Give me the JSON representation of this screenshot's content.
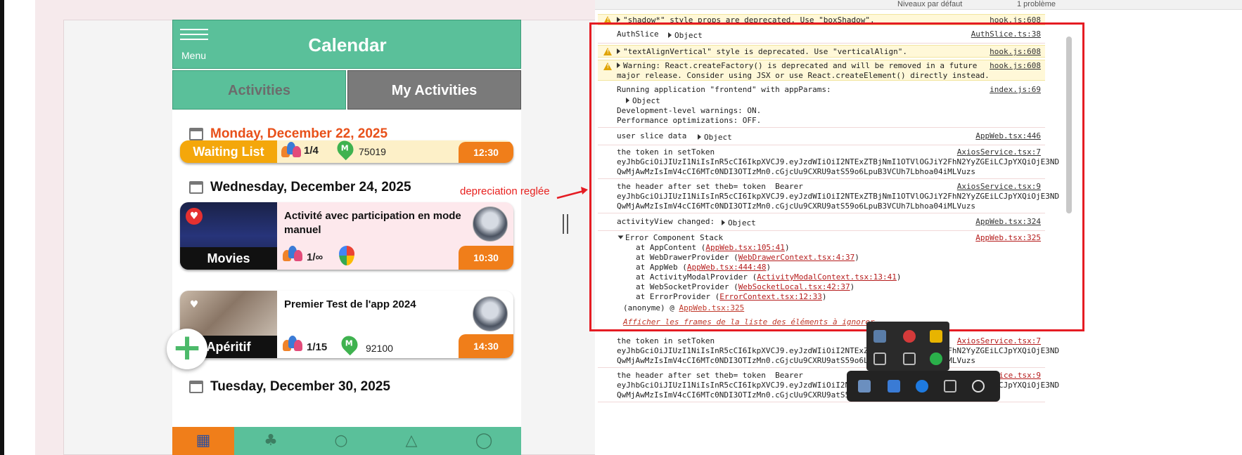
{
  "app": {
    "menu_label": "Menu",
    "title": "Calendar",
    "tabs": [
      "Activities",
      "My Activities"
    ]
  },
  "feed": {
    "sections": [
      {
        "date": "Monday, December 22, 2025",
        "date_color": "#e8501a",
        "card": {
          "category": "Waiting List",
          "participants": "1/4",
          "postal_code": "75019",
          "time": "12:30"
        }
      },
      {
        "date": "Wednesday, December 24, 2025",
        "card": {
          "title": "Activité avec participation en mode manuel",
          "category": "Movies",
          "participants": "1/∞",
          "time": "10:30"
        }
      },
      {
        "card": {
          "title": "Premier Test de l'app 2024",
          "category": "Apéritif",
          "participants": "1/15",
          "postal_code": "92100",
          "time": "14:30"
        }
      },
      {
        "date": "Tuesday, December 30, 2025"
      }
    ],
    "fab_label": "+"
  },
  "annotation": {
    "text": "depreciation reglée"
  },
  "console": {
    "top_bar": [
      "Niveaux par défaut",
      "1 problème"
    ],
    "messages": [
      {
        "level": "warning",
        "text": "\"shadow*\" style props are deprecated. Use \"boxShadow\".",
        "source": "hook.js:608"
      },
      {
        "level": "info",
        "text": "AuthSlice",
        "object": "Object",
        "source": "AuthSlice.ts:38"
      },
      {
        "level": "warning",
        "text": "\"textAlignVertical\" style is deprecated. Use \"verticalAlign\".",
        "source": "hook.js:608"
      },
      {
        "level": "warning",
        "text": "Warning: React.createFactory() is deprecated and will be removed in a future\nmajor release. Consider using JSX or use React.createElement() directly instead.",
        "source": "hook.js:608"
      },
      {
        "level": "info",
        "text": "Running application \"frontend\" with appParams:",
        "object": "Object",
        "text2": "Development-level warnings: ON.\nPerformance optimizations: OFF.",
        "source": "index.js:69"
      },
      {
        "level": "info",
        "text": "user slice data",
        "object": "Object",
        "source": "AppWeb.tsx:446"
      },
      {
        "level": "info",
        "text": "the token in setToken\neyJhbGciOiJIUzI1NiIsInR5cCI6IkpXVCJ9.eyJzdWIiOiI2NTExZTBjNmI1OTVlOGJiY2FhN2YyZGEiLCJpYXQiOjE3ND\nQwMjAwMzIsImV4cCI6MTc0NDI3OTIzMn0.cGjcUu9CXRU9atS59o6LpuB3VCUh7Lbhoa04iMLVuzs",
        "source": "AxiosService.tsx:7"
      },
      {
        "level": "info",
        "text": "the header after set theb= token  Bearer\neyJhbGciOiJIUzI1NiIsInR5cCI6IkpXVCJ9.eyJzdWIiOiI2NTExZTBjNmI1OTVlOGJiY2FhN2YyZGEiLCJpYXQiOjE3ND\nQwMjAwMzIsImV4cCI6MTc0NDI3OTIzMn0.cGjcUu9CXRU9atS59o6LpuB3VCUh7Lbhoa04iMLVuzs",
        "source": "AxiosService.tsx:9"
      },
      {
        "level": "info",
        "text": "activityView changed:",
        "object": "Object",
        "source": "AppWeb.tsx:324"
      },
      {
        "level": "error",
        "text": "Error Component Stack",
        "source": "AppWeb.tsx:325"
      }
    ],
    "stack": [
      {
        "prefix": "at AppContent (",
        "link": "AppWeb.tsx:105:41",
        "suffix": ")"
      },
      {
        "prefix": "at WebDrawerProvider (",
        "link": "WebDrawerContext.tsx:4:37",
        "suffix": ")"
      },
      {
        "prefix": "at AppWeb (",
        "link": "AppWeb.tsx:444:48",
        "suffix": ")"
      },
      {
        "prefix": "at ActivityModalProvider (",
        "link": "ActivityModalContext.tsx:13:41",
        "suffix": ")"
      },
      {
        "prefix": "at WebSocketProvider (",
        "link": "WebSocketLocal.tsx:42:37",
        "suffix": ")"
      },
      {
        "prefix": "at ErrorProvider (",
        "link": "ErrorContext.tsx:12:33",
        "suffix": ")"
      }
    ],
    "anon_prefix": "(anonyme) @ ",
    "anon_link": "AppWeb.tsx:325",
    "hint": "Afficher les frames de la liste des éléments à ignorer",
    "after": [
      {
        "text": "the token in setToken\neyJhbGciOiJIUzI1NiIsInR5cCI6IkpXVCJ9.eyJzdWIiOiI2NTExZTBjNmI1OTVlOGJiY2FhN2YyZGEiLCJpYXQiOjE3ND\nQwMjAwMzIsImV4cCI6MTc0NDI3OTIzMn0.cGjcUu9CXRU9atS59o6LpuB3VCUh7Lbhoa04iMLVuzs",
        "source": "AxiosService.tsx:7"
      },
      {
        "text": "the header after set theb= token  Bearer\neyJhbGciOiJIUzI1NiIsInR5cCI6IkpXVCJ9.eyJzdWIiOiI2NTExZTBjNmI1OTVlOGJiY2FhN2YyZGEiLCJpYXQiOjE3ND\nQwMjAwMzIsImV4cCI6MTc0NDI3OTIzMn0.cGjcUu9CXRU9atS59o6LpuB3VCUh7Lbhoa04iMLVuzs",
        "source": "AxiosService.tsx:9"
      }
    ]
  },
  "colors": {
    "green": "#5ac09a",
    "orange": "#f07e1a",
    "red_box": "#e51c23",
    "warning_bg": "#fff8d8"
  },
  "icons": [
    "menu-icon",
    "calendar-icon",
    "heart-icon",
    "people-icon",
    "location-icon",
    "google-maps-icon",
    "avatar",
    "warning-icon",
    "expand-triangle-icon",
    "plus-icon"
  ]
}
